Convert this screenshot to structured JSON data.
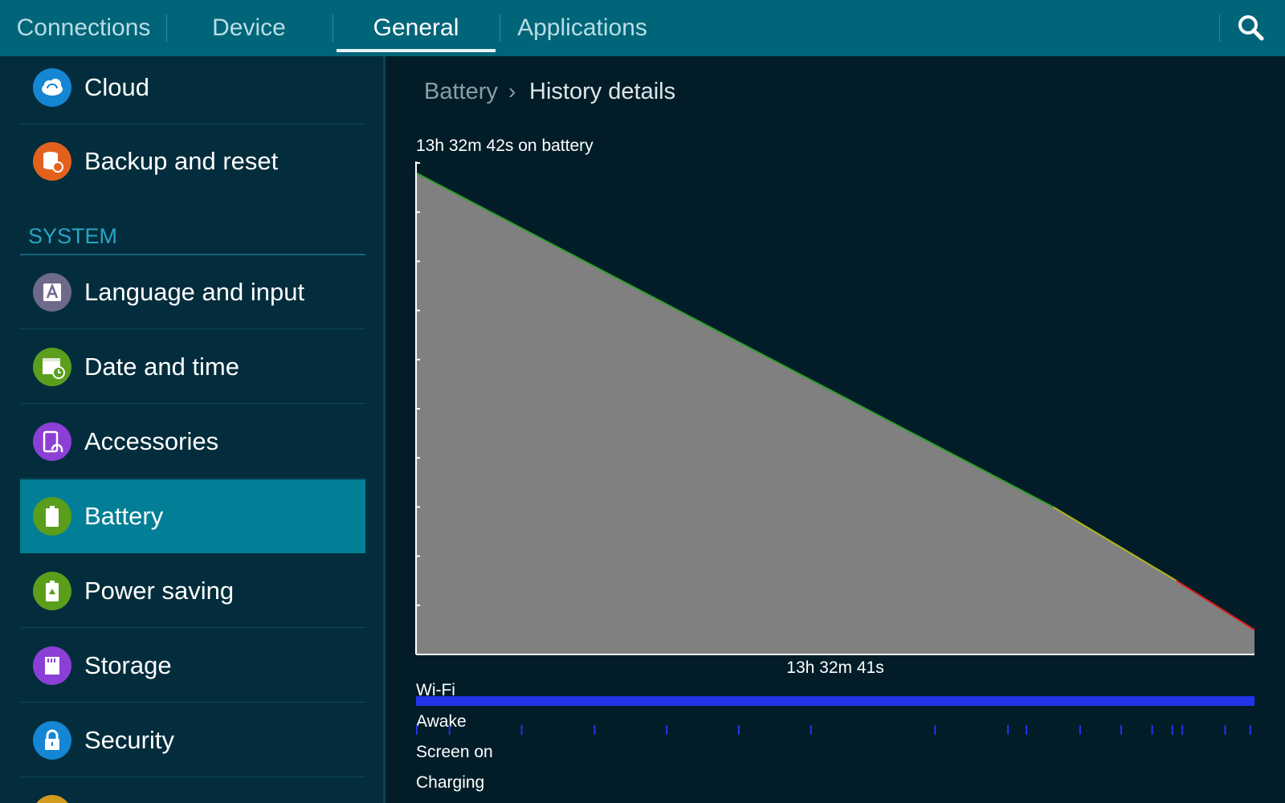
{
  "tabs": [
    {
      "label": "Connections"
    },
    {
      "label": "Device"
    },
    {
      "label": "General",
      "active": true
    },
    {
      "label": "Applications"
    }
  ],
  "toolbar": {
    "search_icon": "search-icon"
  },
  "sidebar": {
    "items_top": [
      {
        "label": "Cloud",
        "icon": "cloud-sync-icon",
        "color": "#1486d4"
      },
      {
        "label": "Backup and reset",
        "icon": "backup-icon",
        "color": "#e2621d"
      }
    ],
    "section_header": "SYSTEM",
    "items": [
      {
        "label": "Language and input",
        "icon": "language-icon",
        "color": "#6f6a8c"
      },
      {
        "label": "Date and time",
        "icon": "calendar-clock-icon",
        "color": "#5a9e1c"
      },
      {
        "label": "Accessories",
        "icon": "accessories-icon",
        "color": "#8c3fd6"
      },
      {
        "label": "Battery",
        "icon": "battery-icon",
        "color": "#5a9e1c",
        "selected": true
      },
      {
        "label": "Power saving",
        "icon": "power-saving-icon",
        "color": "#5a9e1c"
      },
      {
        "label": "Storage",
        "icon": "storage-icon",
        "color": "#8c3fd6"
      },
      {
        "label": "Security",
        "icon": "lock-icon",
        "color": "#1486d4"
      }
    ]
  },
  "breadcrumb": {
    "parent": "Battery",
    "separator": "›",
    "current": "History details"
  },
  "chart_data": {
    "type": "area",
    "title": "13h 32m 42s on battery",
    "x_label": "13h 32m 41s",
    "x_unit": "elapsed fraction",
    "x": [
      0,
      0.76,
      0.907,
      1
    ],
    "y": [
      98,
      30,
      15,
      5
    ],
    "y_range": [
      0,
      100
    ],
    "ticks_count": 10,
    "segment_colors": {
      "high": "#2fa12a",
      "medium": "#b2b517",
      "low": "#e11b1b"
    },
    "fill_color": "#808080"
  },
  "tracks": {
    "wifi_label": "Wi-Fi",
    "awake_label": "Awake",
    "screen_on_label": "Screen on",
    "charging_label": "Charging",
    "wifi_color": "#2234ea",
    "awake_color": "#2234ea",
    "awake_ticks": [
      0.0,
      0.04,
      0.126,
      0.213,
      0.299,
      0.385,
      0.471,
      0.619,
      0.706,
      0.728,
      0.792,
      0.841,
      0.878,
      0.902,
      0.914,
      0.965,
      0.995
    ]
  }
}
